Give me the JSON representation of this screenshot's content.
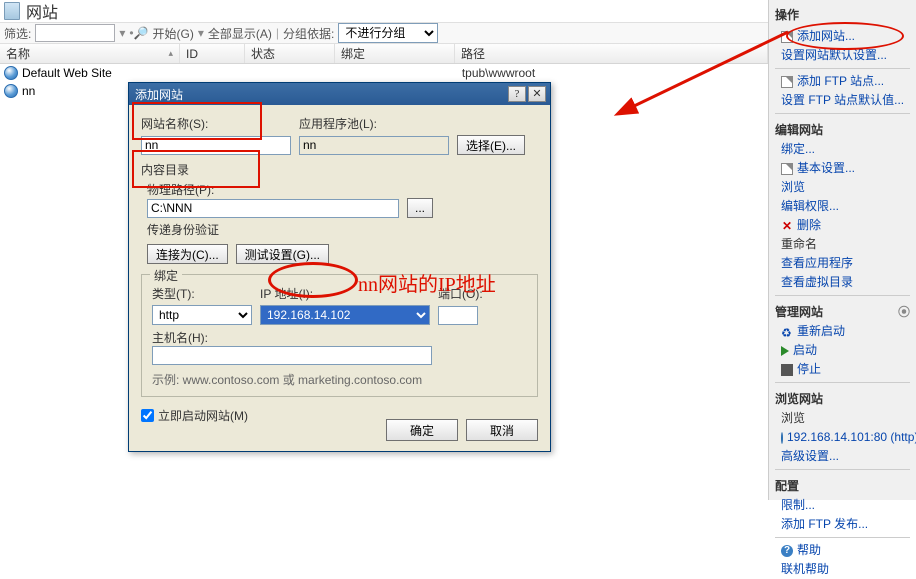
{
  "page": {
    "title": "网站"
  },
  "toolbar": {
    "filter_label": "筛选:",
    "start_label": "开始(G)",
    "showall_label": "全部显示(A)",
    "groupby_label": "分组依据:",
    "groupby_value": "不进行分组"
  },
  "columns": {
    "name": "名称",
    "id": "ID",
    "status": "状态",
    "bind": "绑定",
    "path": "路径"
  },
  "rows": [
    {
      "name": "Default Web Site",
      "path": "tpub\\wwwroot"
    },
    {
      "name": "nn",
      "path": ""
    }
  ],
  "actions": {
    "title": "操作",
    "add_site": "添加网站...",
    "set_defaults": "设置网站默认设置...",
    "add_ftp": "添加 FTP 站点...",
    "set_ftp_defaults": "设置 FTP 站点默认值...",
    "edit_site": "编辑网站",
    "binding": "绑定...",
    "basic": "基本设置...",
    "browse": "浏览",
    "edit_perm": "编辑权限...",
    "delete": "删除",
    "rename": "重命名",
    "view_apps": "查看应用程序",
    "view_vdirs": "查看虚拟目录",
    "manage_site": "管理网站",
    "restart": "重新启动",
    "start": "启动",
    "stop": "停止",
    "browse_site": "浏览网站",
    "browse_label": "浏览",
    "browse_url": "192.168.14.101:80 (http)",
    "adv": "高级设置...",
    "config": "配置",
    "limits": "限制...",
    "add_ftp_pub": "添加 FTP 发布...",
    "help": "帮助",
    "online_help": "联机帮助"
  },
  "dialog": {
    "title": "添加网站",
    "site_name_label": "网站名称(S):",
    "site_name_value": "nn",
    "apppool_label": "应用程序池(L):",
    "apppool_value": "nn",
    "select_btn": "选择(E)...",
    "content_dir": "内容目录",
    "physical_path_label": "物理路径(P):",
    "physical_path_value": "C:\\NNN",
    "passthrough": "传递身份验证",
    "connect_as": "连接为(C)...",
    "test_settings": "测试设置(G)...",
    "binding_legend": "绑定",
    "type_label": "类型(T):",
    "type_value": "http",
    "ip_label": "IP 地址(I):",
    "ip_value": "192.168.14.102",
    "port_label": "端口(O):",
    "port_value": "",
    "hostname_label": "主机名(H):",
    "hostname_value": "",
    "example": "示例: www.contoso.com 或 marketing.contoso.com",
    "start_immediately": "立即启动网站(M)",
    "ok": "确定",
    "cancel": "取消",
    "browse_btn": "..."
  },
  "annotation": "nn网站的IP地址"
}
